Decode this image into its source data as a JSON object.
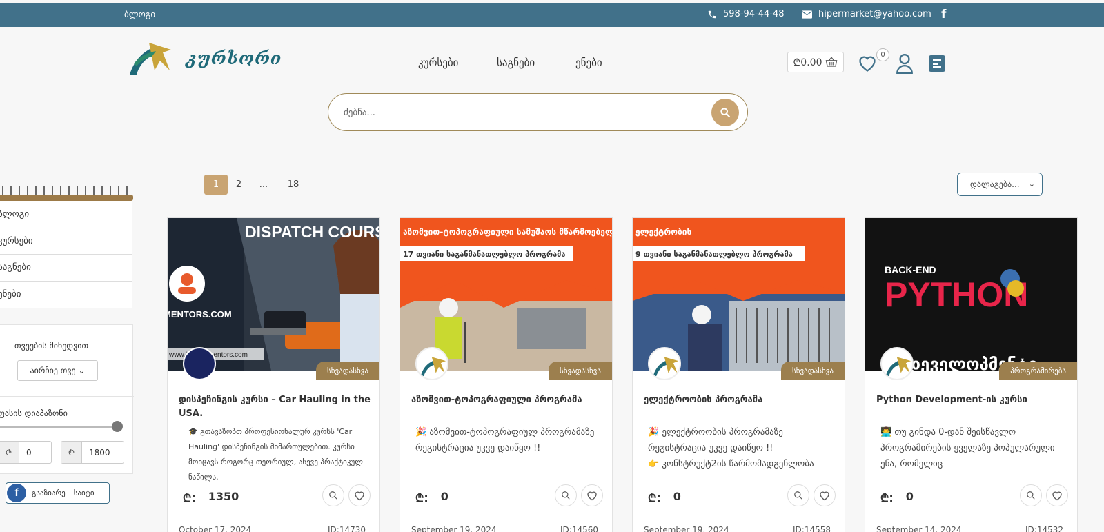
{
  "topbar": {
    "blog": "ბლოგი",
    "phone": "598-94-44-48",
    "email": "hipermarket@yahoo.com",
    "facebook_icon": "facebook-icon"
  },
  "header": {
    "brand": "კურსორი",
    "nav": [
      "კურსები",
      "საგნები",
      "ენები"
    ],
    "cart_total": "₾0.00",
    "wishlist_count": "0"
  },
  "search": {
    "placeholder": "ძებნა..."
  },
  "pagination": {
    "pages": [
      "1",
      "2",
      "...",
      "18"
    ],
    "active": "1"
  },
  "sort": {
    "label": "დალაგება..."
  },
  "sidebar": {
    "menu": [
      "ბლოგი",
      "კურსები",
      "საგნები",
      "ენები"
    ],
    "filter_month_label": "თვეების მიხედვით",
    "month_select": "აირჩიე თვე",
    "price_range_label": "ფასის დიაპაზონი",
    "price_min": "0",
    "price_max": "1800",
    "currency": "₾",
    "share_label": "გააზიარე",
    "share_site": "საიტი"
  },
  "cards": [
    {
      "image_title": "DISPATCH COURSE",
      "image_footer": "MENTORS.COM",
      "image_url_text": "www.haulingmentors.com",
      "category": "სხვადასხვა",
      "title": "დისპეჩინგის კურსი – Car Hauling in the USA.",
      "desc": "🎓 გთავაზობთ პროფესიონალურ კურსს 'Car Hauling' დისპეჩინგის მიმართულებით. კურსი მოიცავს როგორც თეორიულ, ასევე პრაქტიკულ ნაწილს.",
      "currency": "₾:",
      "price": "1350",
      "date": "October 17, 2024",
      "id": "ID:14730"
    },
    {
      "image_title": "აზომვით-ტოპოგრაფიული სამუშაოს მწარმოებელი",
      "image_sub": "17 თვიანი საგანმანათლებლო პროგრამა",
      "category": "სხვადასხვა",
      "title": "აზომვით-ტოპოგრაფიული პროგრამა",
      "desc": "🎉 აზომვით-ტოპოგრაფიულ პროგრამაზე რეგისტრაცია უკვე დაიწყო !!",
      "currency": "₾:",
      "price": "0",
      "date": "September 19, 2024",
      "id": "ID:14560"
    },
    {
      "image_title": "ელექტრობის",
      "image_sub": "9 თვიანი საგანმანათლებლო პროგრამა",
      "category": "სხვადასხვა",
      "title": "ელექტროობის პროგრამა",
      "desc": "🎉 ელექტროობის პროგრამაზე რეგისტრაცია უკვე დაიწყო !!\n👉 კონსტრუქტ2ის წარმომადგენლობა",
      "currency": "₾:",
      "price": "0",
      "date": "September 19, 2024",
      "id": "ID:14558"
    },
    {
      "image_pre": "BACK-END",
      "image_title": "PYTHON",
      "image_bottom": "დეველოპმენტი",
      "category": "პროგრამირება",
      "title": "Python Development-ის კურსი",
      "desc": "👨‍💻 თუ გინდა 0-დან შეისწავლო პროგრამირების ყველაზე პოპულარული ენა, რომელიც",
      "currency": "₾:",
      "price": "0",
      "date": "September 14, 2024",
      "id": "ID:14532"
    }
  ],
  "colors": {
    "topbar": "#41718a",
    "accent": "#c9a472",
    "category": "#9c7f4e"
  }
}
